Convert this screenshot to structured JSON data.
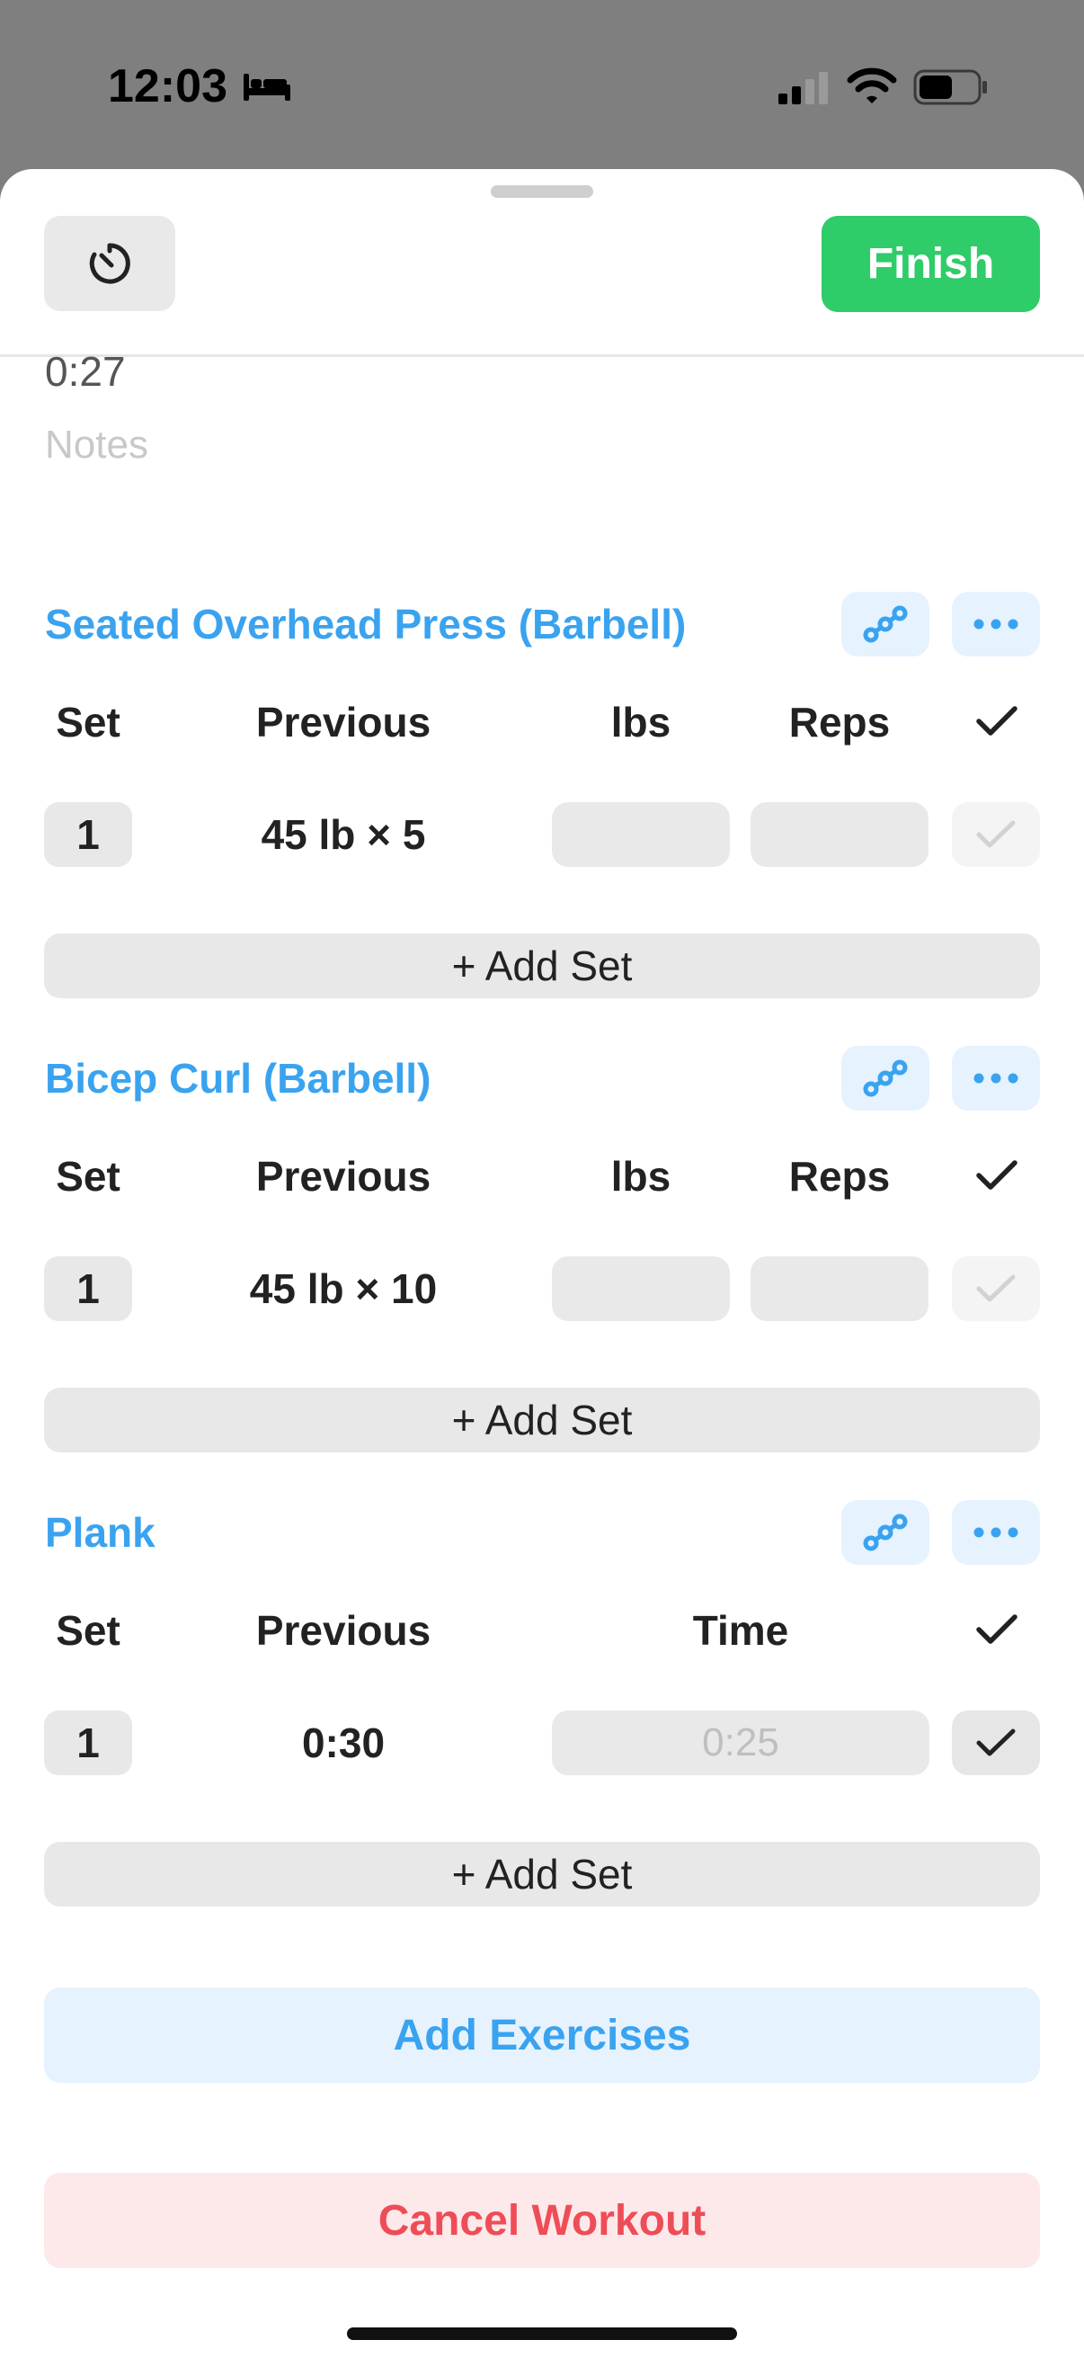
{
  "status_bar": {
    "time": "12:03"
  },
  "header": {
    "finish_label": "Finish"
  },
  "workout": {
    "elapsed": "0:27",
    "notes_placeholder": "Notes"
  },
  "exercises": [
    {
      "title": "Seated Overhead Press (Barbell)",
      "columns": [
        "Set",
        "Previous",
        "lbs",
        "Reps"
      ],
      "sets": [
        {
          "set": "1",
          "previous": "45 lb × 5"
        }
      ],
      "add_set_label": "+ Add Set"
    },
    {
      "title": "Bicep Curl (Barbell)",
      "columns": [
        "Set",
        "Previous",
        "lbs",
        "Reps"
      ],
      "sets": [
        {
          "set": "1",
          "previous": "45 lb × 10"
        }
      ],
      "add_set_label": "+ Add Set"
    },
    {
      "title": "Plank",
      "columns": [
        "Set",
        "Previous",
        "Time"
      ],
      "sets": [
        {
          "set": "1",
          "previous": "0:30",
          "time_placeholder": "0:25"
        }
      ],
      "add_set_label": "+ Add Set"
    }
  ],
  "actions": {
    "add_exercises": "Add Exercises",
    "cancel_workout": "Cancel Workout"
  },
  "colors": {
    "accent": "#3aa3f0",
    "finish": "#2fcc6a",
    "danger": "#ee4d57"
  }
}
